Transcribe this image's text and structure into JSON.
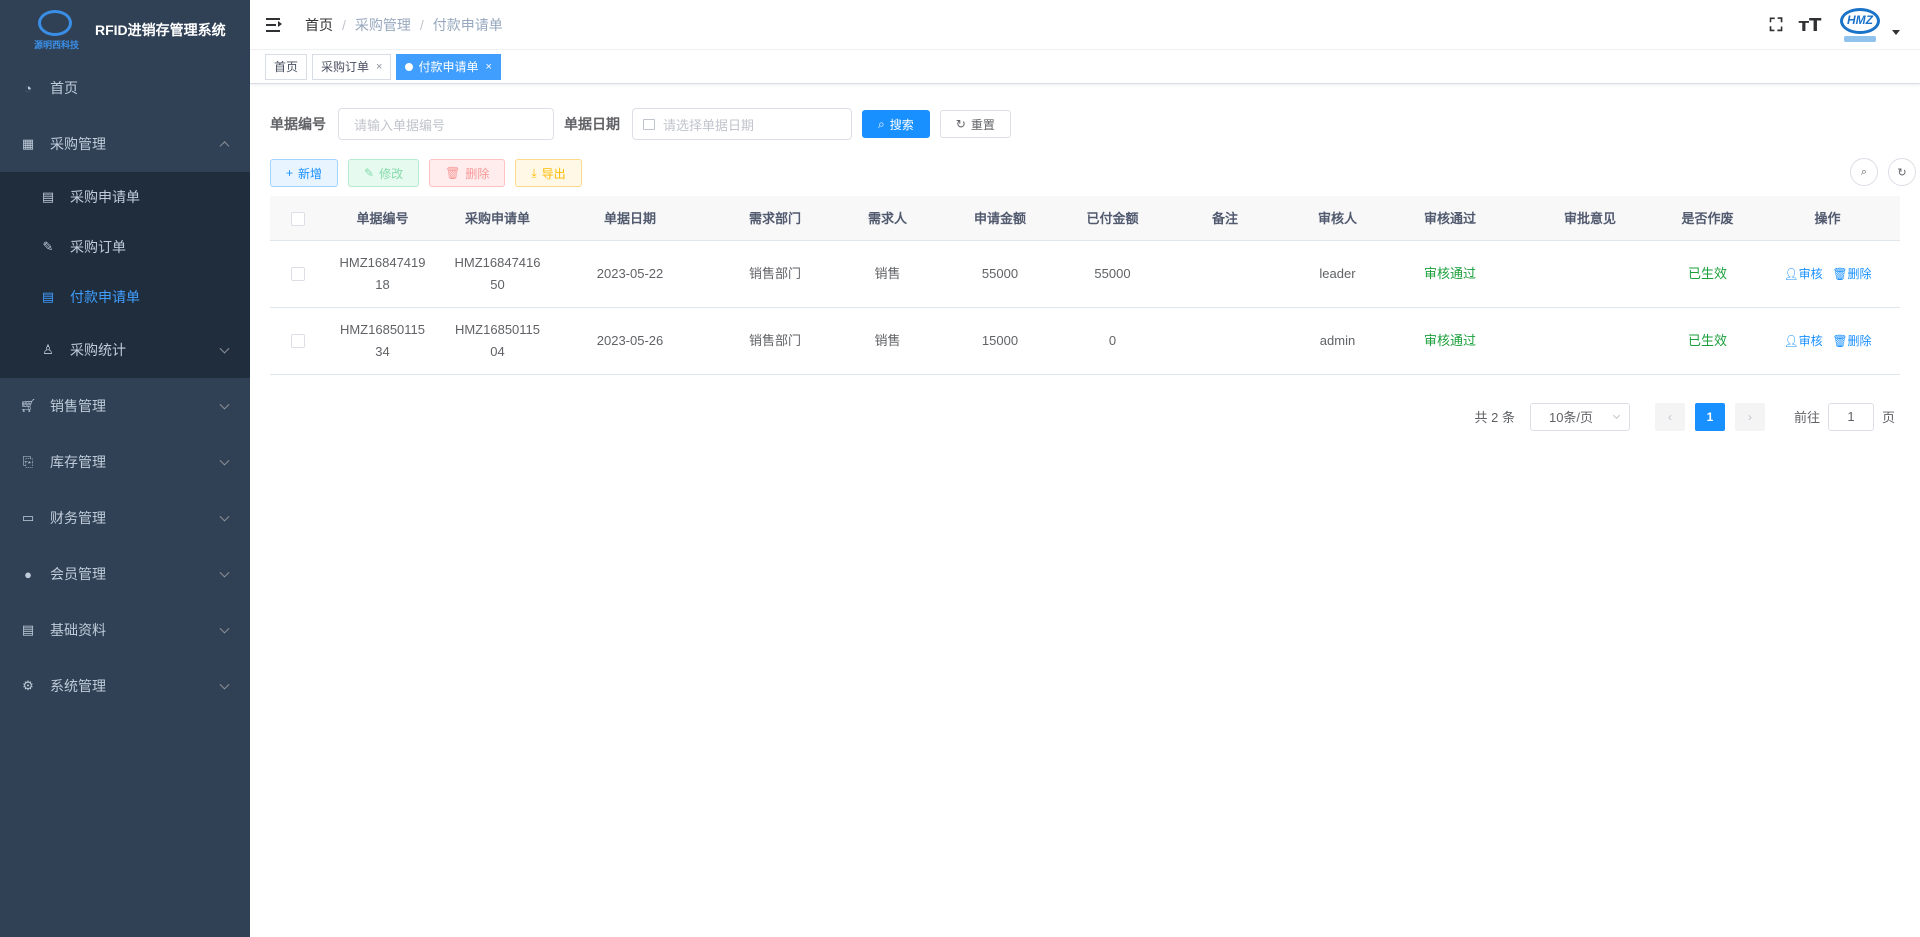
{
  "app": {
    "title": "RFID进销存管理系统",
    "logo_text": "源明西科技",
    "avatar_text": "HMZ"
  },
  "sidebar": {
    "items": [
      {
        "label": "首页",
        "icon": "dashboard-icon"
      },
      {
        "label": "采购管理",
        "icon": "table-icon",
        "expanded": true
      },
      {
        "label": "销售管理",
        "icon": "cart-icon"
      },
      {
        "label": "库存管理",
        "icon": "stock-icon"
      },
      {
        "label": "财务管理",
        "icon": "finance-icon"
      },
      {
        "label": "会员管理",
        "icon": "user-icon"
      },
      {
        "label": "基础资料",
        "icon": "document-icon"
      },
      {
        "label": "系统管理",
        "icon": "gear-icon"
      }
    ],
    "purchase_children": [
      {
        "label": "采购申请单",
        "icon": "document-icon"
      },
      {
        "label": "采购订单",
        "icon": "edit-icon"
      },
      {
        "label": "付款申请单",
        "icon": "document-icon",
        "active": true
      },
      {
        "label": "采购统计",
        "icon": "chart-icon"
      }
    ]
  },
  "navbar": {
    "breadcrumb": [
      "首页",
      "采购管理",
      "付款申请单"
    ],
    "fullscreen_icon": "fullscreen-icon",
    "font_size_icon": "font-size-icon"
  },
  "tags": [
    {
      "label": "首页",
      "closable": false
    },
    {
      "label": "采购订单",
      "closable": true
    },
    {
      "label": "付款申请单",
      "closable": true,
      "active": true
    }
  ],
  "search": {
    "bill_no_label": "单据编号",
    "bill_no_placeholder": "请输入单据编号",
    "date_label": "单据日期",
    "date_placeholder": "请选择单据日期",
    "search_btn": "搜索",
    "reset_btn": "重置"
  },
  "toolbar": {
    "add": "新增",
    "edit": "修改",
    "delete": "删除",
    "export": "导出"
  },
  "table": {
    "columns": [
      "单据编号",
      "采购申请单",
      "单据日期",
      "需求部门",
      "需求人",
      "申请金额",
      "已付金额",
      "备注",
      "审核人",
      "审核通过",
      "审批意见",
      "是否作废",
      "操作"
    ],
    "rows": [
      {
        "bill_no_1": "HMZ16847419",
        "bill_no_2": "18",
        "req_1": "HMZ16847416",
        "req_2": "50",
        "date": "2023-05-22",
        "dept": "销售部门",
        "person": "销售",
        "amount": "55000",
        "paid": "55000",
        "remark": "",
        "auditor": "leader",
        "audit_status": "审核通过",
        "opinion": "",
        "void": "已生效",
        "op_audit": "审核",
        "op_delete": "删除"
      },
      {
        "bill_no_1": "HMZ16850115",
        "bill_no_2": "34",
        "req_1": "HMZ16850115",
        "req_2": "04",
        "date": "2023-05-26",
        "dept": "销售部门",
        "person": "销售",
        "amount": "15000",
        "paid": "0",
        "remark": "",
        "auditor": "admin",
        "audit_status": "审核通过",
        "opinion": "",
        "void": "已生效",
        "op_audit": "审核",
        "op_delete": "删除"
      }
    ]
  },
  "pagination": {
    "total": "共 2 条",
    "page_size": "10条/页",
    "current": "1",
    "goto_prefix": "前往",
    "goto_value": "1",
    "goto_suffix": "页"
  },
  "colors": {
    "sidebar_bg": "#304156",
    "submenu_bg": "#1f2d3d",
    "primary": "#1890ff",
    "success": "#1a9f3a"
  }
}
